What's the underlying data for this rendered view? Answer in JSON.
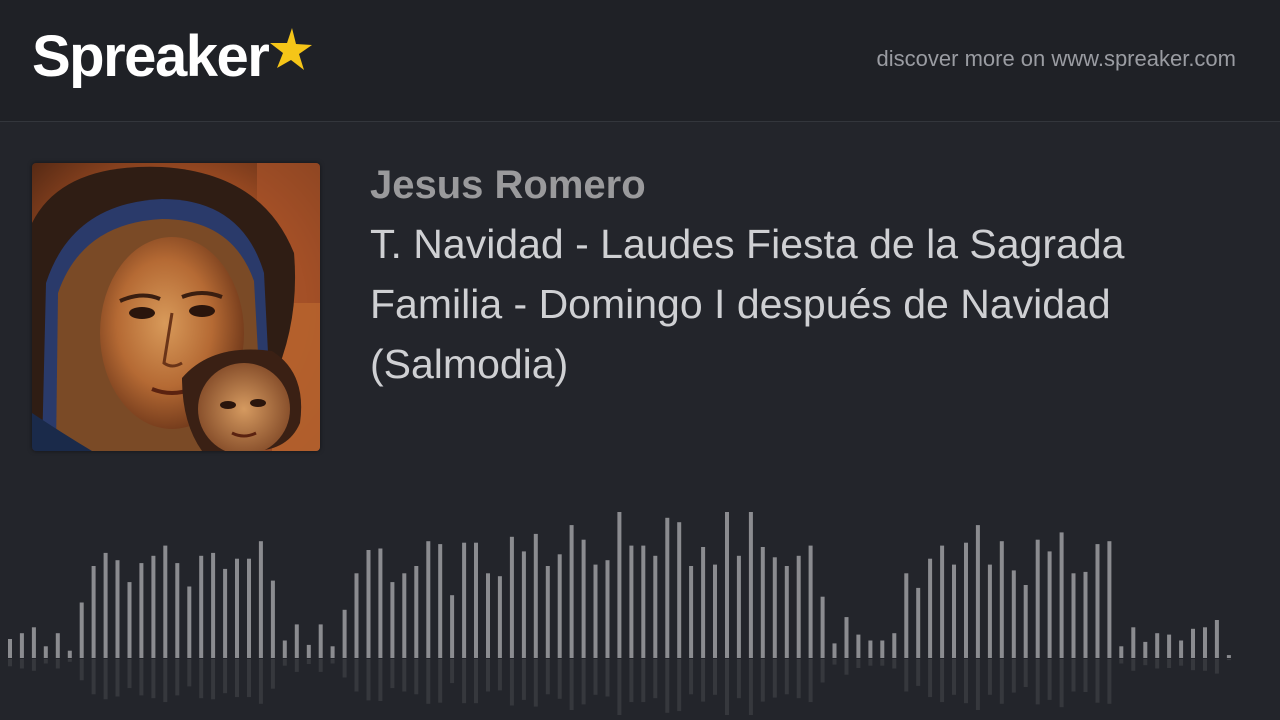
{
  "header": {
    "logo_text": "Spreaker",
    "logo_star_color": "#f5c518",
    "discover_text": "discover more on www.spreaker.com"
  },
  "episode": {
    "author": "Jesus Romero",
    "title": "T. Navidad - Laudes Fiesta de la Sagrada Familia - Domingo I después de Navidad (Salmodia)",
    "cover_icon": "virgin-and-child-icon-artwork"
  },
  "waveform": {
    "bar_color": "#8b8c90",
    "reflection_color": "#36383d",
    "levels": [
      0.13,
      0.17,
      0.21,
      0.08,
      0.17,
      0.05,
      0.38,
      0.63,
      0.72,
      0.67,
      0.52,
      0.65,
      0.7,
      0.77,
      0.65,
      0.49,
      0.7,
      0.72,
      0.61,
      0.68,
      0.68,
      0.8,
      0.53,
      0.12,
      0.23,
      0.09,
      0.23,
      0.08,
      0.33,
      0.58,
      0.74,
      0.75,
      0.52,
      0.58,
      0.63,
      0.8,
      0.78,
      0.43,
      0.79,
      0.79,
      0.58,
      0.56,
      0.83,
      0.73,
      0.85,
      0.63,
      0.71,
      0.91,
      0.81,
      0.64,
      0.67,
      1.0,
      0.77,
      0.77,
      0.7,
      0.96,
      0.93,
      0.63,
      0.76,
      0.64,
      1.0,
      0.7,
      1.0,
      0.76,
      0.69,
      0.63,
      0.7,
      0.77,
      0.42,
      0.1,
      0.28,
      0.16,
      0.12,
      0.12,
      0.17,
      0.58,
      0.48,
      0.68,
      0.77,
      0.64,
      0.79,
      0.91,
      0.64,
      0.8,
      0.6,
      0.5,
      0.81,
      0.73,
      0.86,
      0.58,
      0.59,
      0.78,
      0.8,
      0.08,
      0.21,
      0.11,
      0.17,
      0.16,
      0.12,
      0.2,
      0.21,
      0.26,
      0.02
    ]
  }
}
